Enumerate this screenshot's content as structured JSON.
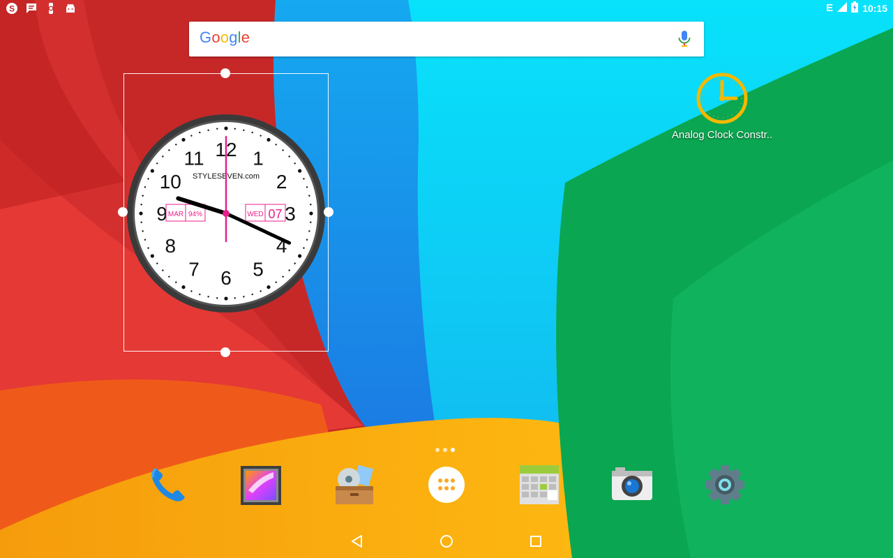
{
  "status_bar": {
    "left_icons": [
      "skype-icon",
      "messages-icon",
      "watch-icon",
      "android-icon"
    ],
    "network": "E",
    "time": "10:15"
  },
  "search": {
    "logo_letters": [
      {
        "char": "G",
        "color": "#4285F4"
      },
      {
        "char": "o",
        "color": "#EA4335"
      },
      {
        "char": "o",
        "color": "#FBBC05"
      },
      {
        "char": "g",
        "color": "#4285F4"
      },
      {
        "char": "l",
        "color": "#34A853"
      },
      {
        "char": "e",
        "color": "#EA4335"
      }
    ],
    "mic_icon": "mic-icon"
  },
  "widget": {
    "brand": "STYLESEVEN.com",
    "month": "MAR",
    "battery": "94%",
    "weekday": "WED",
    "day": "07",
    "numerals": [
      "12",
      "1",
      "2",
      "3",
      "4",
      "5",
      "6",
      "7",
      "8",
      "9",
      "10",
      "11"
    ],
    "time": {
      "hours": 10,
      "minutes": 15,
      "seconds": 58
    },
    "accent": "#e91e8c"
  },
  "shortcut": {
    "label": "Analog Clock Constr..",
    "icon": "clock-icon",
    "color": "#f5b800"
  },
  "page_dots": [
    false,
    false,
    true
  ],
  "dock": [
    {
      "name": "phone-icon"
    },
    {
      "name": "gallery-icon"
    },
    {
      "name": "files-icon"
    },
    {
      "name": "all-apps-icon"
    },
    {
      "name": "calendar-app-icon"
    },
    {
      "name": "camera-icon"
    },
    {
      "name": "settings-icon"
    }
  ],
  "nav": [
    "back-icon",
    "home-icon",
    "recents-icon"
  ]
}
